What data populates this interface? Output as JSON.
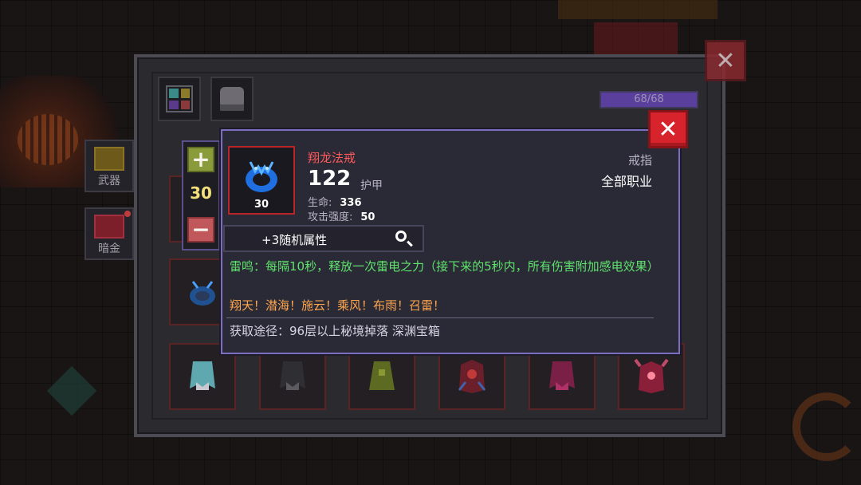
{
  "capacity": "68/68",
  "side_tabs": {
    "weapon": "武器",
    "dark_gold": "暗金"
  },
  "stepper": {
    "value": "30",
    "plus": "+",
    "minus": "−"
  },
  "tooltip": {
    "item_name": "翔龙法戒",
    "item_level": "30",
    "armor_value": "122",
    "armor_label": "护甲",
    "stats": [
      {
        "label": "生命:",
        "value": "336"
      },
      {
        "label": "攻击强度:",
        "value": "50"
      }
    ],
    "item_type": "戒指",
    "item_class": "全部职业",
    "random_attributes": "+3随机属性",
    "effect": "雷鸣：每隔10秒，释放一次雷电之力（接下来的5秒内，所有伤害附加感电效果）",
    "flavor": "翔天！潜海！施云！乘风！布雨！召雷！",
    "source": "获取途径：96层以上秘境掉落 深渊宝箱"
  },
  "colors": {
    "legendary_red": "#ff5a5a",
    "effect_green": "#5fe36c",
    "flavor_orange": "#ffa64d",
    "close_red": "#d7232b"
  },
  "icons": {
    "panel_close": "✕",
    "tooltip_close": "✕"
  }
}
